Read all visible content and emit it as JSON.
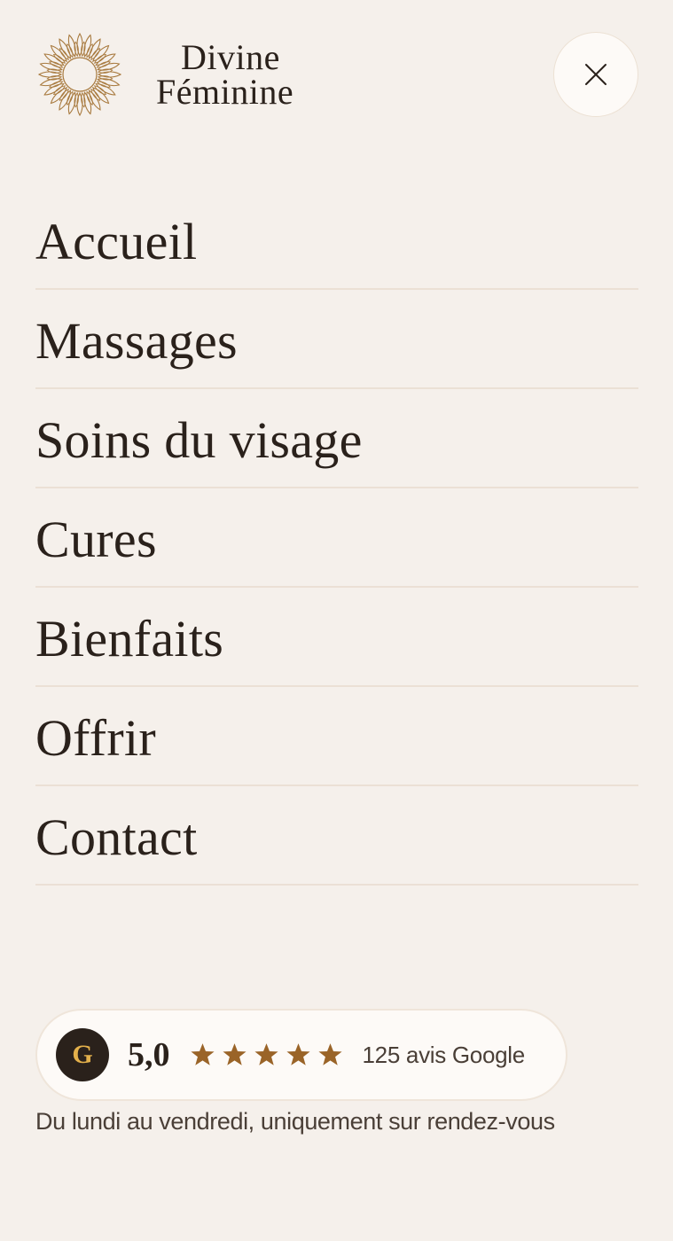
{
  "brand": {
    "line1": "Divine",
    "line2": "Féminine",
    "logo_icon": "sun-flower-icon",
    "accent_color": "#a87a3f"
  },
  "header": {
    "close_icon": "close-icon"
  },
  "nav": {
    "items": [
      {
        "label": "Accueil"
      },
      {
        "label": "Massages"
      },
      {
        "label": "Soins du visage"
      },
      {
        "label": "Cures"
      },
      {
        "label": "Bienfaits"
      },
      {
        "label": "Offrir"
      },
      {
        "label": "Contact"
      }
    ]
  },
  "reviews": {
    "badge_letter": "G",
    "rating": "5,0",
    "stars_filled": 5,
    "stars_total": 5,
    "star_color": "#9a6428",
    "count_text": "125 avis Google"
  },
  "footer": {
    "hours": "Du lundi au vendredi, uniquement sur rendez-vous"
  },
  "colors": {
    "background": "#f5f0eb",
    "text": "#2a211b",
    "divider": "#ebe0d5",
    "badge_bg": "#2a211b",
    "badge_letter": "#e3b04b"
  }
}
